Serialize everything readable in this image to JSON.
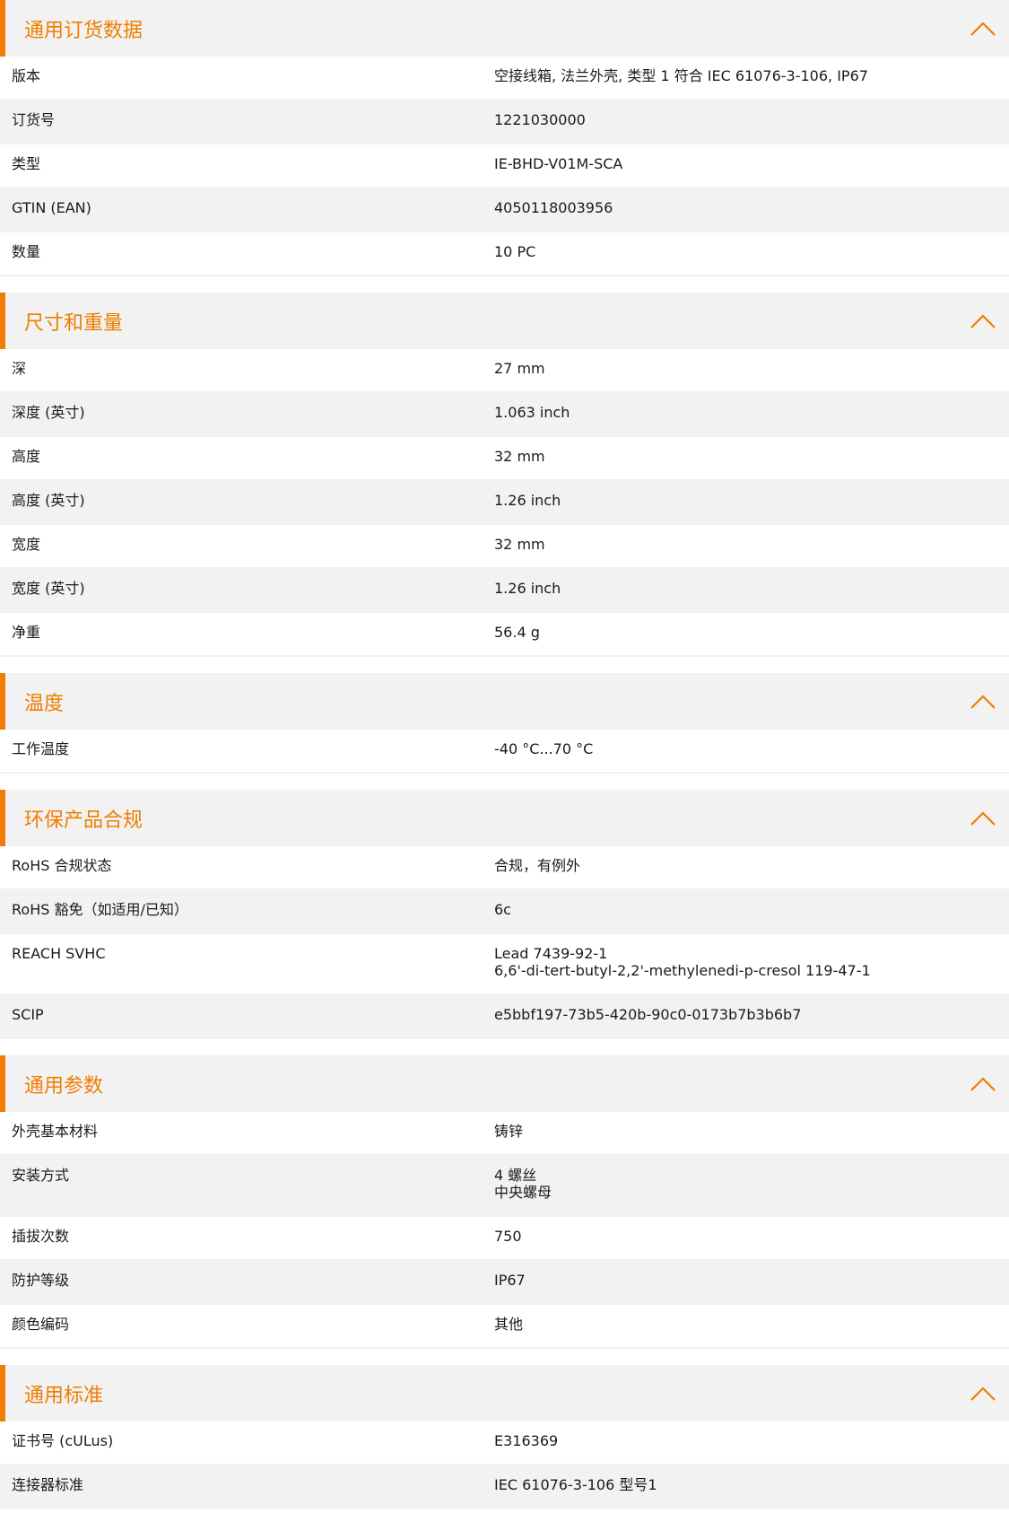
{
  "sections": [
    {
      "title": "通用订货数据",
      "rows": [
        {
          "label": "版本",
          "value": "空接线箱, 法兰外壳, 类型 1 符合 IEC 61076-3-106, IP67"
        },
        {
          "label": "订货号",
          "value": "1221030000"
        },
        {
          "label": "类型",
          "value": "IE-BHD-V01M-SCA"
        },
        {
          "label": "GTIN (EAN)",
          "value": "4050118003956"
        },
        {
          "label": "数量",
          "value": "10  PC"
        }
      ]
    },
    {
      "title": "尺寸和重量",
      "rows": [
        {
          "label": "深",
          "value": "27  mm"
        },
        {
          "label": "深度 (英寸)",
          "value": "1.063  inch"
        },
        {
          "label": "高度",
          "value": "32  mm"
        },
        {
          "label": "高度 (英寸)",
          "value": "1.26  inch"
        },
        {
          "label": "宽度",
          "value": "32  mm"
        },
        {
          "label": "宽度 (英寸)",
          "value": "1.26  inch"
        },
        {
          "label": "净重",
          "value": "56.4  g"
        }
      ]
    },
    {
      "title": "温度",
      "rows": [
        {
          "label": "工作温度",
          "value": "-40 °C...70 °C"
        }
      ]
    },
    {
      "title": "环保产品合规",
      "rows": [
        {
          "label": "RoHS 合规状态",
          "value": "合规，有例外"
        },
        {
          "label": "RoHS 豁免（如适用/已知）",
          "value": "6c"
        },
        {
          "label": "REACH SVHC",
          "value": "Lead 7439-92-1\n6,6'-di-tert-butyl-2,2'-methylenedi-p-cresol 119-47-1"
        },
        {
          "label": "SCIP",
          "value": "e5bbf197-73b5-420b-90c0-0173b7b3b6b7"
        }
      ]
    },
    {
      "title": "通用参数",
      "rows": [
        {
          "label": "外壳基本材料",
          "value": "铸锌"
        },
        {
          "label": "安装方式",
          "value": "4 螺丝\n中央螺母"
        },
        {
          "label": "插拔次数",
          "value": "750"
        },
        {
          "label": "防护等级",
          "value": "IP67"
        },
        {
          "label": "颜色编码",
          "value": "其他"
        }
      ]
    },
    {
      "title": "通用标准",
      "rows": [
        {
          "label": "证书号 (cULus)",
          "value": "E316369"
        },
        {
          "label": "连接器标准",
          "value": "IEC 61076-3-106 型号1"
        }
      ]
    }
  ],
  "colors": {
    "accent": "#f07d00",
    "stripe": "#f2f2f2"
  },
  "icons": {
    "collapse": "chevron-up-icon"
  }
}
